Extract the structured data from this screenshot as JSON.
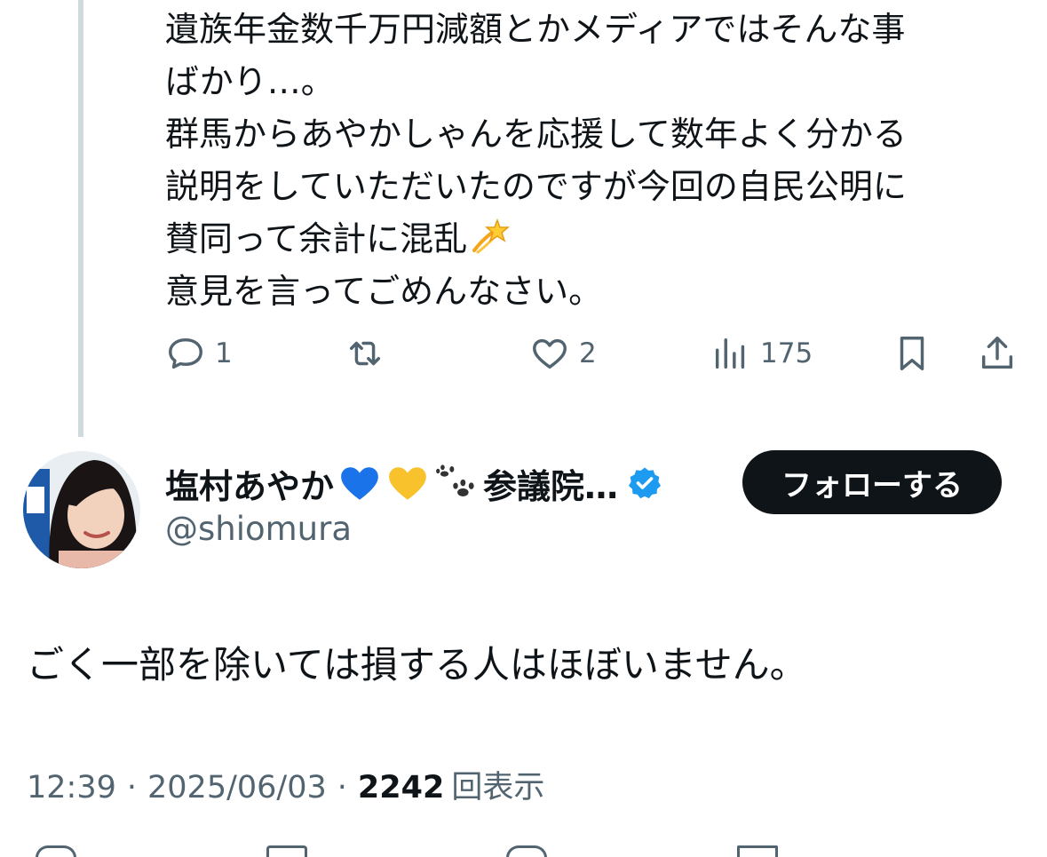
{
  "reply": {
    "lines": [
      "遺族年金数千万円減額とかメディアではそんな事",
      "ばかり…。",
      "群馬からあやかしゃんを応援して数年よく分かる",
      "説明をしていただいたのですが今回の自民公明に",
      "賛同って余計に混乱",
      "意見を言ってごめんなさい。"
    ],
    "emoji": "dizzy-emoji",
    "actions": {
      "reply_count": "1",
      "retweet_count": "",
      "like_count": "2",
      "views_count": "175"
    }
  },
  "author": {
    "display_name": "塩村あやか",
    "display_name_suffix": "参議院…",
    "emojis": [
      "blue-heart-emoji",
      "yellow-heart-emoji",
      "paw-prints-emoji"
    ],
    "handle": "@shiomura",
    "verified": true,
    "follow_label": "フォローする"
  },
  "tweet": {
    "text": "ごく一部を除いては損する人はほぼいません。",
    "time": "12:39",
    "date": "2025/06/03",
    "separator": "·",
    "views": "2242",
    "views_label": "回表示"
  },
  "colors": {
    "text": "#0f1419",
    "secondary": "#536471",
    "verified": "#1d9bf0",
    "thread_line": "#cfd9de",
    "follow_bg": "#0f1419"
  }
}
